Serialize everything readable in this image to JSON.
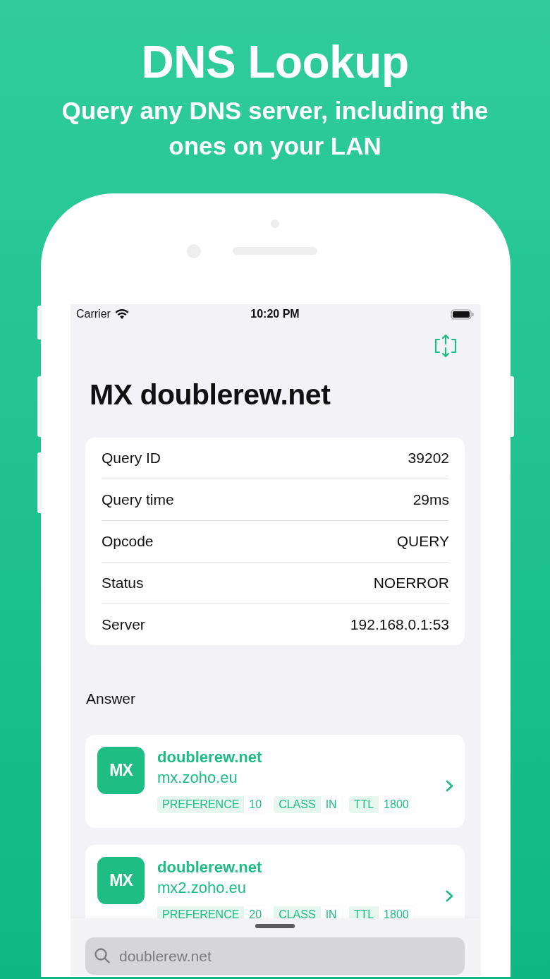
{
  "header": {
    "title": "DNS Lookup",
    "subtitle": "Query any DNS server, including the ones on your LAN"
  },
  "status_bar": {
    "carrier": "Carrier",
    "time": "10:20 PM"
  },
  "page_title": "MX doublerew.net",
  "query_info": [
    {
      "label": "Query ID",
      "value": "39202"
    },
    {
      "label": "Query time",
      "value": "29ms"
    },
    {
      "label": "Opcode",
      "value": "QUERY"
    },
    {
      "label": "Status",
      "value": "NOERROR"
    },
    {
      "label": "Server",
      "value": "192.168.0.1:53"
    }
  ],
  "answer": {
    "heading": "Answer",
    "records": [
      {
        "type": "MX",
        "name": "doublerew.net",
        "target": "mx.zoho.eu",
        "tags": [
          {
            "key": "PREFERENCE",
            "value": "10"
          },
          {
            "key": "CLASS",
            "value": "IN"
          },
          {
            "key": "TTL",
            "value": "1800"
          }
        ]
      },
      {
        "type": "MX",
        "name": "doublerew.net",
        "target": "mx2.zoho.eu",
        "tags": [
          {
            "key": "PREFERENCE",
            "value": "20"
          },
          {
            "key": "CLASS",
            "value": "IN"
          },
          {
            "key": "TTL",
            "value": "1800"
          }
        ]
      }
    ]
  },
  "search": {
    "placeholder": "doublerew.net"
  }
}
